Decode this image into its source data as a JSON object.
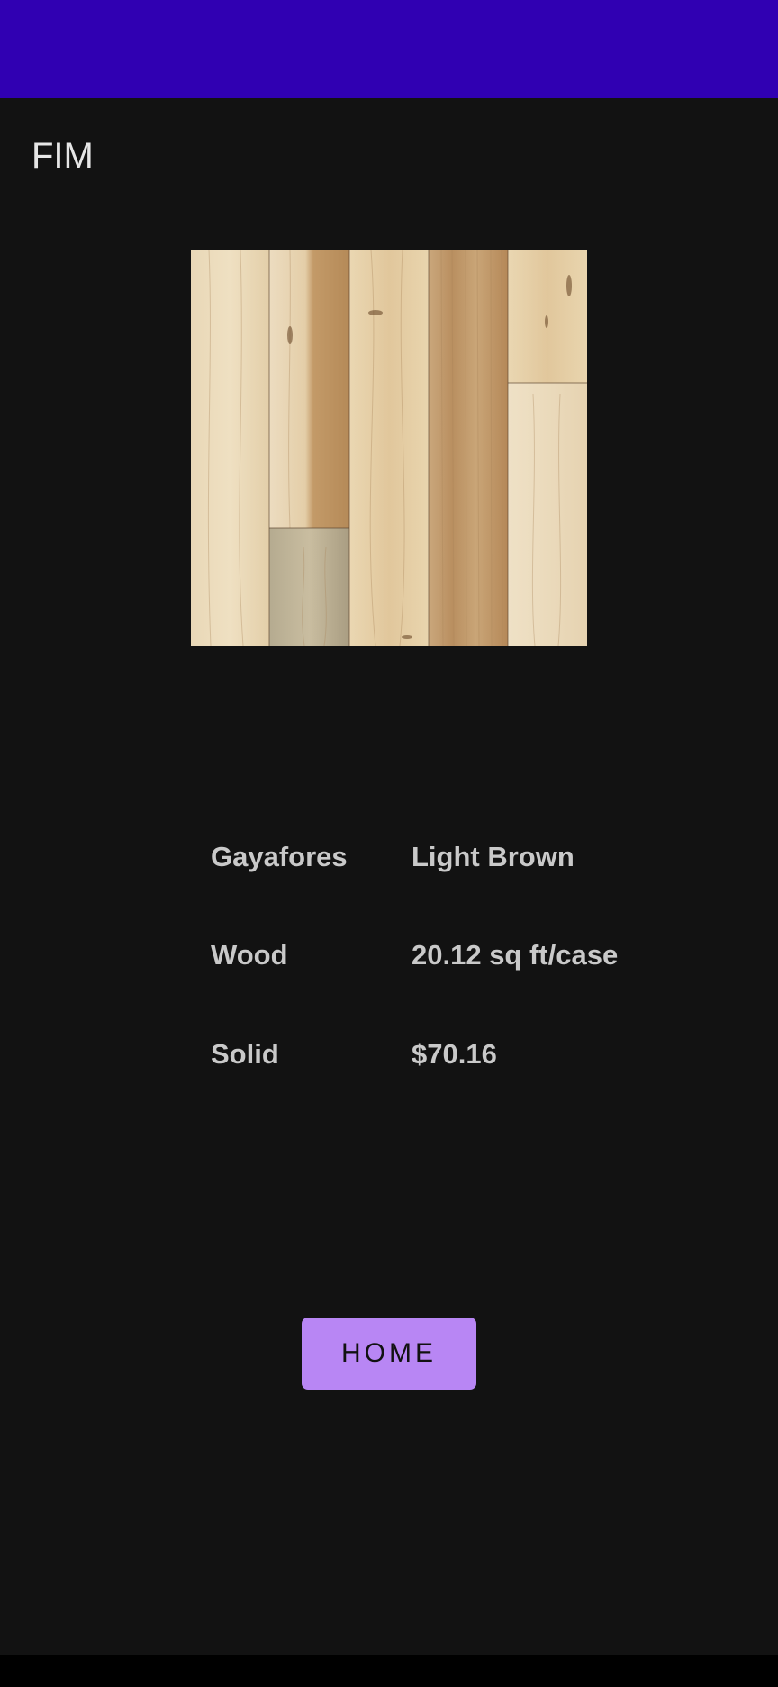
{
  "app": {
    "title": "FIM"
  },
  "colors": {
    "status_bar": "#3000B2",
    "background": "#121212",
    "button": "#B886F4",
    "detail_text": "#C9C9C9"
  },
  "product": {
    "image_icon": "wood-flooring-image",
    "rows": [
      {
        "left": "Gayafores",
        "right": "Light Brown"
      },
      {
        "left": "Wood",
        "right": "20.12 sq ft/case"
      },
      {
        "left": "Solid",
        "right": "$70.16"
      }
    ]
  },
  "actions": {
    "home_label": "HOME"
  }
}
